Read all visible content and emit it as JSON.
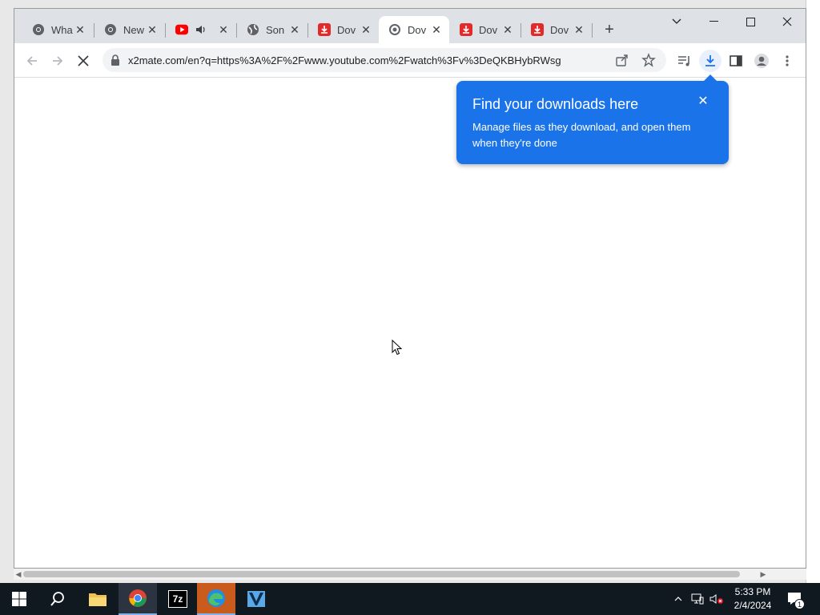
{
  "browser": {
    "tabs": [
      {
        "label": "Wha",
        "icon": "chrome-icon"
      },
      {
        "label": "New",
        "icon": "chrome-icon"
      },
      {
        "label": "",
        "icon": "youtube-icon",
        "audio": true
      },
      {
        "label": "Son",
        "icon": "globe-icon"
      },
      {
        "label": "Dov",
        "icon": "download-site-icon"
      },
      {
        "label": "Dov",
        "icon": "loading-icon",
        "active": true
      },
      {
        "label": "Dov",
        "icon": "download-site-icon"
      },
      {
        "label": "Dov",
        "icon": "download-site-icon"
      }
    ],
    "url": "x2mate.com/en?q=https%3A%2F%2Fwww.youtube.com%2Fwatch%3Fv%3DeQKBHybRWsg",
    "accent": "#1a73e8"
  },
  "downloads_bubble": {
    "title": "Find your downloads here",
    "body": "Manage files as they download, and open them when they're done"
  },
  "taskbar": {
    "time": "5:33 PM",
    "date": "2/4/2024",
    "notification_count": "1",
    "archive_label": "7z"
  }
}
